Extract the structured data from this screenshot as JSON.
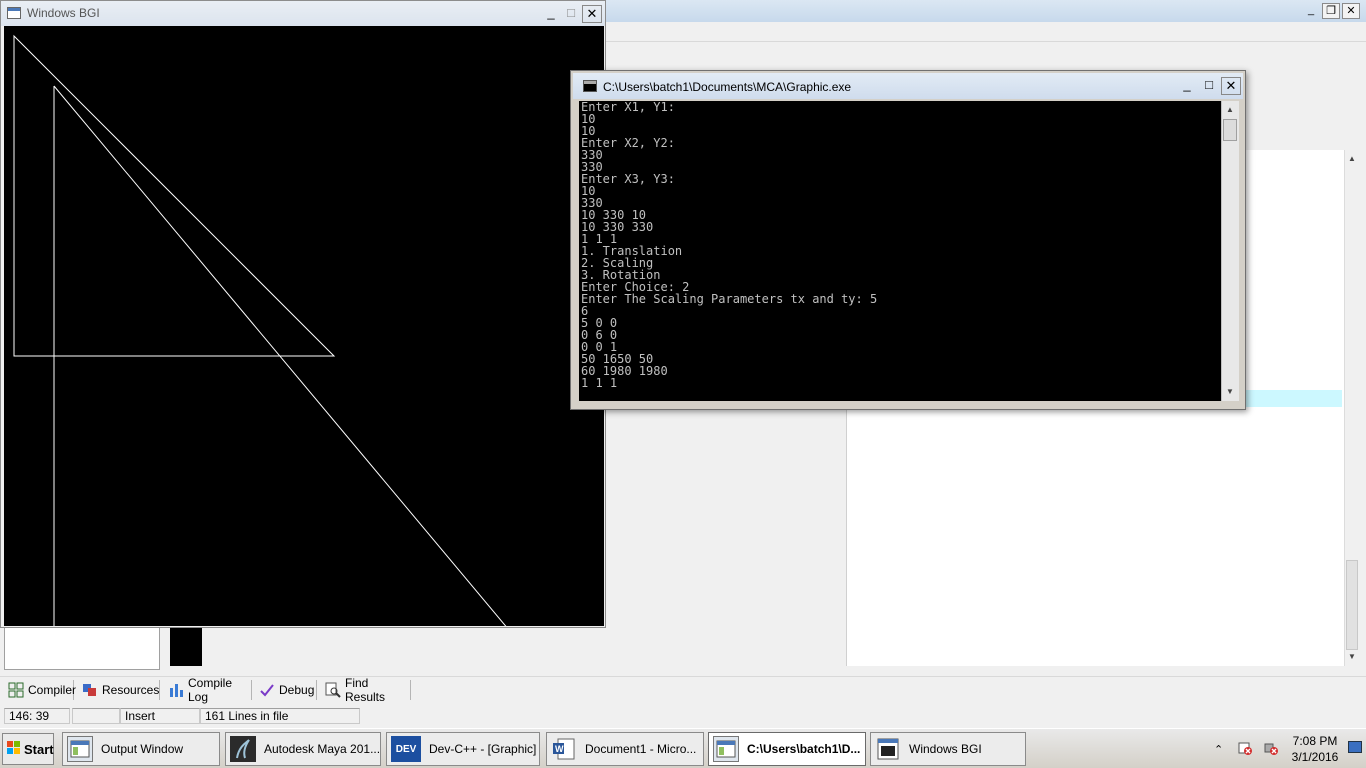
{
  "bgi_window": {
    "title": "Windows BGI",
    "buttons": {
      "minimize": "_",
      "maximize": "□",
      "close": "✕"
    }
  },
  "console_window": {
    "title": "C:\\Users\\batch1\\Documents\\MCA\\Graphic.exe",
    "lines": [
      "Enter X1, Y1:",
      "10",
      "10",
      "Enter X2, Y2:",
      "330",
      "330",
      "Enter X3, Y3:",
      "10",
      "330",
      "10 330 10",
      "10 330 330",
      "1 1 1",
      "1. Translation",
      "2. Scaling",
      "3. Rotation",
      "Enter Choice: 2",
      "Enter The Scaling Parameters tx and ty: 5",
      "6",
      "5 0 0",
      "0 6 0",
      "0 0 1",
      "50 1650 50",
      "60 1980 1980",
      "1 1 1",
      "_"
    ],
    "buttons": {
      "minimize": "_",
      "maximize": "□",
      "close": "✕"
    }
  },
  "dev_window": {
    "buttons": {
      "minimize": "_",
      "restore": "❐",
      "close": "✕"
    },
    "tabs": [
      {
        "label": "Compiler",
        "icon": "grid-icon"
      },
      {
        "label": "Resources",
        "icon": "resources-icon"
      },
      {
        "label": "Compile Log",
        "icon": "chart-icon"
      },
      {
        "label": "Debug",
        "icon": "check-icon"
      },
      {
        "label": "Find Results",
        "icon": "find-icon"
      }
    ],
    "status": {
      "position": "146: 39",
      "blank": "",
      "mode": "Insert",
      "lines": "161 Lines in file"
    }
  },
  "taskbar": {
    "start_label": "Start",
    "items": [
      {
        "label": "Output Window",
        "icon": "window-icon",
        "active": false
      },
      {
        "label": "Autodesk Maya 201...",
        "icon": "maya-icon",
        "active": false
      },
      {
        "label": "Dev-C++ - [Graphic]",
        "icon": "devcpp-icon",
        "icon_text": "DEV",
        "active": false
      },
      {
        "label": "Document1 - Micro...",
        "icon": "word-icon",
        "active": false
      },
      {
        "label": "C:\\Users\\batch1\\D...",
        "icon": "console-icon",
        "active": true
      },
      {
        "label": "Windows BGI",
        "icon": "bgi-icon",
        "active": false
      }
    ],
    "clock": {
      "time": "7:08 PM",
      "date": "3/1/2016"
    }
  },
  "colors": {
    "console_text": "#c0c0c0",
    "canvas_bg": "#000000",
    "line_color": "#ffffff",
    "editor_highlight": "#ccf8ff"
  }
}
